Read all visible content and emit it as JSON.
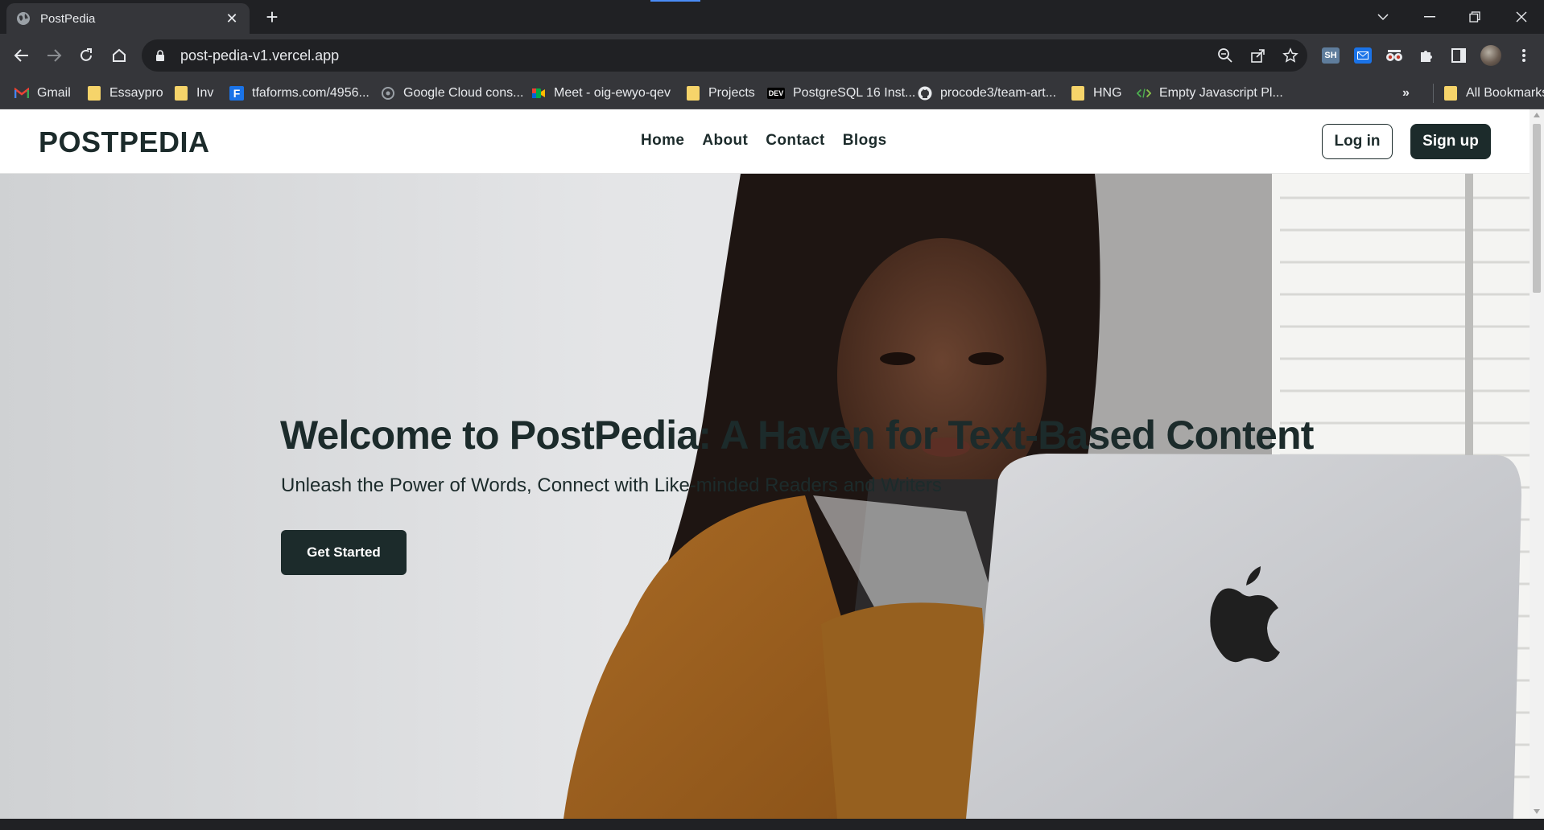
{
  "browser": {
    "tab_title": "PostPedia",
    "url": "post-pedia-v1.vercel.app",
    "bookmarks": [
      {
        "label": "Gmail",
        "icon": "gmail-icon"
      },
      {
        "label": "Essaypro",
        "icon": "folder-icon"
      },
      {
        "label": "Inv",
        "icon": "folder-icon"
      },
      {
        "label": "tfaforms.com/4956...",
        "icon": "formassembly-icon"
      },
      {
        "label": "Google Cloud cons...",
        "icon": "google-cloud-icon"
      },
      {
        "label": "Meet - oig-ewyo-qev",
        "icon": "meet-icon"
      },
      {
        "label": "Projects",
        "icon": "folder-icon"
      },
      {
        "label": "PostgreSQL 16 Inst...",
        "icon": "dev-icon"
      },
      {
        "label": "procode3/team-art...",
        "icon": "github-icon"
      },
      {
        "label": "HNG",
        "icon": "folder-icon"
      },
      {
        "label": "Empty Javascript Pl...",
        "icon": "code-icon"
      }
    ],
    "bookmarks_overflow": "»",
    "all_bookmarks": "All Bookmarks",
    "ext_sh_label": "SH",
    "dev_badge": "DEV"
  },
  "site": {
    "logo": "POSTPEDIA",
    "nav": [
      "Home",
      "About",
      "Contact",
      "Blogs"
    ],
    "login": "Log in",
    "signup": "Sign up"
  },
  "hero": {
    "title": "Welcome to PostPedia: A Haven for Text-Based Content",
    "subtitle": "Unleash the Power of Words, Connect with Like-minded Readers and Writers",
    "cta": "Get Started"
  },
  "colors": {
    "brand_dark": "#1c2b2b",
    "chrome_bg": "#202124",
    "chrome_toolbar": "#35363a"
  }
}
